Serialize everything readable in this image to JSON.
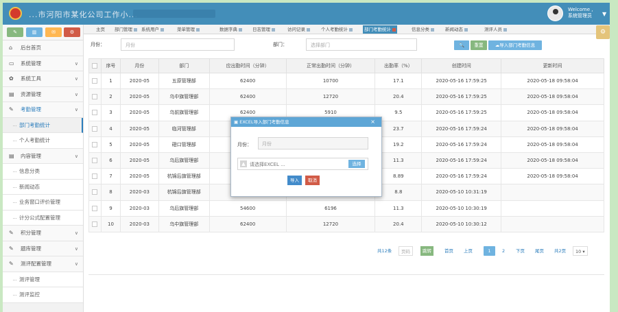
{
  "header": {
    "app_title": "...市河阳市某化公司工作小...",
    "welcome_line1": "Welcome ,",
    "welcome_line2": "系统管理员",
    "caret": "▼"
  },
  "shortcuts": [
    "✎",
    "▥",
    "✉",
    "⚙"
  ],
  "sidebar": [
    {
      "icon": "⌂",
      "label": "后台首页",
      "chev": "",
      "kind": "top"
    },
    {
      "icon": "▭",
      "label": "系统管理",
      "chev": "∨",
      "kind": "top"
    },
    {
      "icon": "✿",
      "label": "系统工具",
      "chev": "∨",
      "kind": "top"
    },
    {
      "icon": "▤",
      "label": "资源管理",
      "chev": "∨",
      "kind": "top"
    },
    {
      "icon": "✎",
      "label": "考勤管理",
      "chev": "∨",
      "kind": "active-parent"
    },
    {
      "icon": "",
      "label": "部门考勤统计",
      "chev": "",
      "kind": "active-sub"
    },
    {
      "icon": "",
      "label": "个人考勤统计",
      "chev": "",
      "kind": "sub"
    },
    {
      "icon": "▤",
      "label": "内容管理",
      "chev": "∨",
      "kind": "top"
    },
    {
      "icon": "",
      "label": "信息分类",
      "chev": "",
      "kind": "sub"
    },
    {
      "icon": "",
      "label": "新闻动态",
      "chev": "",
      "kind": "sub"
    },
    {
      "icon": "",
      "label": "业务窗口评价管理",
      "chev": "",
      "kind": "sub"
    },
    {
      "icon": "",
      "label": "计分公式配置管理",
      "chev": "",
      "kind": "sub"
    },
    {
      "icon": "✎",
      "label": "积分管理",
      "chev": "∨",
      "kind": "top"
    },
    {
      "icon": "✎",
      "label": "题库管理",
      "chev": "∨",
      "kind": "top"
    },
    {
      "icon": "✎",
      "label": "测评配置管理",
      "chev": "∨",
      "kind": "top"
    },
    {
      "icon": "",
      "label": "测评管理",
      "chev": "",
      "kind": "sub"
    },
    {
      "icon": "",
      "label": "测评监控",
      "chev": "",
      "kind": "sub"
    }
  ],
  "tabs": [
    {
      "label": "主页",
      "closable": false,
      "active": false
    },
    {
      "label": "部门管理",
      "closable": true,
      "active": false
    },
    {
      "label": "系统用户",
      "closable": true,
      "active": false
    },
    {
      "label": "菜单管理",
      "closable": true,
      "active": false
    },
    {
      "label": "数据字典",
      "closable": true,
      "active": false
    },
    {
      "label": "日志管理",
      "closable": true,
      "active": false
    },
    {
      "label": "访问记录",
      "closable": true,
      "active": false
    },
    {
      "label": "个人考勤统计",
      "closable": true,
      "active": false
    },
    {
      "label": "部门考勤统计",
      "closable": true,
      "active": true
    },
    {
      "label": "信息分类",
      "closable": true,
      "active": false
    },
    {
      "label": "新闻动态",
      "closable": true,
      "active": false
    },
    {
      "label": "测评人员",
      "closable": true,
      "active": false
    }
  ],
  "filter": {
    "month_label": "月份：",
    "month_placeholder": "月份",
    "dept_label": "部门：",
    "dept_placeholder": "选择部门",
    "search_icon": "🔍",
    "reset_label": "重置",
    "import_label": "导入部门考勤信息"
  },
  "table": {
    "columns": [
      "",
      "序号",
      "月份",
      "部门",
      "应出勤时间（分钟）",
      "正常出勤时间（分钟）",
      "出勤率（%）",
      "创建时间",
      "更新时间"
    ],
    "rows": [
      [
        "1",
        "2020-05",
        "五原管理部",
        "62400",
        "10700",
        "17.1",
        "2020-05-16 17:59:25",
        "2020-05-18 09:58:04"
      ],
      [
        "2",
        "2020-05",
        "乌中旗管理部",
        "62400",
        "12720",
        "20.4",
        "2020-05-16 17:59:25",
        "2020-05-18 09:58:04"
      ],
      [
        "3",
        "2020-05",
        "乌前旗管理部",
        "62400",
        "5910",
        "9.5",
        "2020-05-16 17:59:25",
        "2020-05-18 09:58:04"
      ],
      [
        "4",
        "2020-05",
        "临河管理部",
        "",
        "",
        "23.7",
        "2020-05-16 17:59:24",
        "2020-05-18 09:58:04"
      ],
      [
        "5",
        "2020-05",
        "磴口管理部",
        "",
        "",
        "19.2",
        "2020-05-16 17:59:24",
        "2020-05-18 09:58:04"
      ],
      [
        "6",
        "2020-05",
        "乌后旗管理部",
        "",
        "",
        "11.3",
        "2020-05-16 17:59:24",
        "2020-05-18 09:58:04"
      ],
      [
        "7",
        "2020-05",
        "杭锦后旗管理部",
        "",
        "",
        "8.89",
        "2020-05-16 17:59:24",
        "2020-05-18 09:58:04"
      ],
      [
        "8",
        "2020-03",
        "杭锦后旗管理部",
        "",
        "",
        "8.8",
        "2020-05-10 10:31:19",
        ""
      ],
      [
        "9",
        "2020-03",
        "乌后旗管理部",
        "54600",
        "6196",
        "11.3",
        "2020-05-10 10:30:19",
        ""
      ],
      [
        "10",
        "2020-03",
        "乌中旗管理部",
        "62400",
        "12720",
        "20.4",
        "2020-05-10 10:30:12",
        ""
      ]
    ]
  },
  "pager": {
    "total": "共12条",
    "page_input": "页码",
    "jump": "跳转",
    "first": "首页",
    "prev": "上页",
    "page1": "1",
    "page2": "2",
    "next": "下页",
    "last": "尾页",
    "pages": "共2页",
    "size": "10 ▾"
  },
  "modal": {
    "title": "EXCEL导入部门考勤信息",
    "close": "×",
    "month_label": "月份：",
    "month_placeholder": "月份",
    "file_placeholder": "请选择EXCEL ...",
    "choose_label": "选择",
    "import_label": "导入",
    "cancel_label": "取消"
  },
  "colors": {
    "topbar": "#438eb9",
    "accent": "#6fb3e0",
    "green": "#87b87f",
    "red": "#d15b47",
    "frame": "#c9e8c2"
  }
}
